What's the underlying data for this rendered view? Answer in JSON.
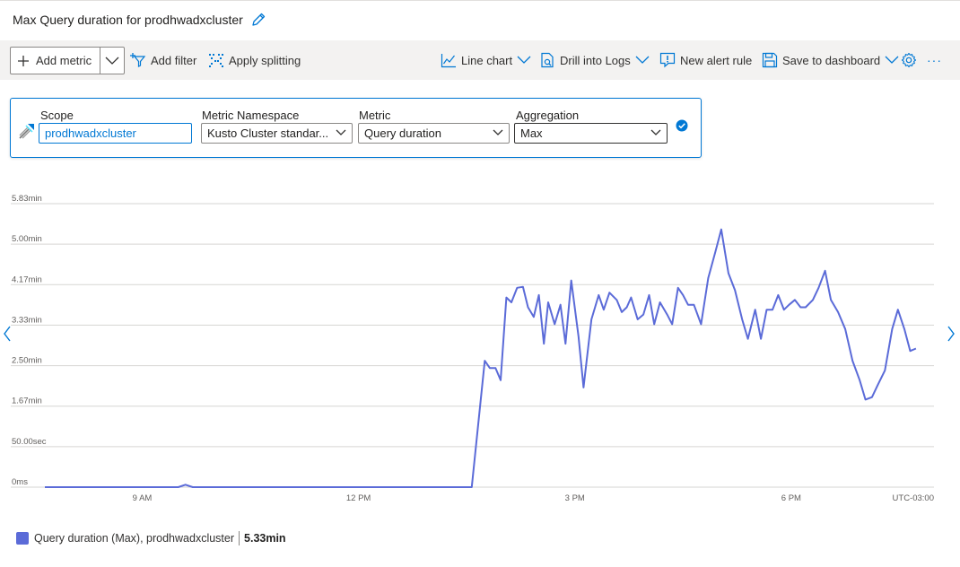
{
  "title": "Max Query duration for prodhwadxcluster",
  "toolbar": {
    "add_metric": "Add metric",
    "add_filter": "Add filter",
    "apply_splitting": "Apply splitting",
    "line_chart": "Line chart",
    "drill_logs": "Drill into Logs",
    "new_alert": "New alert rule",
    "save_dashboard": "Save to dashboard",
    "more": "···"
  },
  "metric_card": {
    "scope_label": "Scope",
    "scope_value": "prodhwadxcluster",
    "namespace_label": "Metric Namespace",
    "namespace_value": "Kusto Cluster standar...",
    "metric_label": "Metric",
    "metric_value": "Query duration",
    "aggregation_label": "Aggregation",
    "aggregation_value": "Max"
  },
  "colors": {
    "accent": "#0078d4",
    "series": "#5b6bd8",
    "grid": "#d6d5d3"
  },
  "chart_data": {
    "type": "line",
    "y_tick_labels": [
      "0ms",
      "50.00sec",
      "1.67min",
      "2.50min",
      "3.33min",
      "4.17min",
      "5.00min",
      "5.83min"
    ],
    "ylim": [
      0,
      5.83
    ],
    "y_unit": "min",
    "x_tick_labels": [
      "9 AM",
      "12 PM",
      "3 PM",
      "6 PM"
    ],
    "x_tick_hours": [
      9,
      12,
      15,
      18
    ],
    "timezone_label": "UTC-03:00",
    "xlim_hours": [
      7.65,
      19.98
    ],
    "series": [
      {
        "name": "Query duration (Max), prodhwadxcluster",
        "points": [
          [
            7.65,
            0
          ],
          [
            9.5,
            0
          ],
          [
            9.6,
            0.05
          ],
          [
            9.7,
            0
          ],
          [
            13.57,
            0
          ],
          [
            13.75,
            2.6
          ],
          [
            13.82,
            2.45
          ],
          [
            13.9,
            2.45
          ],
          [
            13.97,
            2.2
          ],
          [
            14.05,
            3.9
          ],
          [
            14.12,
            3.8
          ],
          [
            14.2,
            4.1
          ],
          [
            14.28,
            4.12
          ],
          [
            14.35,
            3.7
          ],
          [
            14.43,
            3.5
          ],
          [
            14.5,
            3.95
          ],
          [
            14.57,
            2.95
          ],
          [
            14.63,
            3.8
          ],
          [
            14.72,
            3.35
          ],
          [
            14.8,
            3.75
          ],
          [
            14.87,
            2.95
          ],
          [
            14.95,
            4.25
          ],
          [
            15.05,
            3.1
          ],
          [
            15.12,
            2.05
          ],
          [
            15.23,
            3.45
          ],
          [
            15.33,
            3.95
          ],
          [
            15.4,
            3.65
          ],
          [
            15.48,
            4.0
          ],
          [
            15.58,
            3.85
          ],
          [
            15.65,
            3.6
          ],
          [
            15.72,
            3.7
          ],
          [
            15.78,
            3.9
          ],
          [
            15.87,
            3.45
          ],
          [
            15.95,
            3.55
          ],
          [
            16.03,
            3.95
          ],
          [
            16.1,
            3.35
          ],
          [
            16.18,
            3.8
          ],
          [
            16.28,
            3.55
          ],
          [
            16.35,
            3.35
          ],
          [
            16.43,
            4.1
          ],
          [
            16.5,
            3.95
          ],
          [
            16.57,
            3.75
          ],
          [
            16.65,
            3.75
          ],
          [
            16.75,
            3.35
          ],
          [
            16.85,
            4.3
          ],
          [
            16.95,
            4.85
          ],
          [
            17.03,
            5.3
          ],
          [
            17.13,
            4.4
          ],
          [
            17.22,
            4.05
          ],
          [
            17.32,
            3.45
          ],
          [
            17.4,
            3.05
          ],
          [
            17.5,
            3.65
          ],
          [
            17.58,
            3.05
          ],
          [
            17.66,
            3.65
          ],
          [
            17.74,
            3.65
          ],
          [
            17.82,
            3.95
          ],
          [
            17.9,
            3.65
          ],
          [
            17.97,
            3.75
          ],
          [
            18.05,
            3.85
          ],
          [
            18.13,
            3.7
          ],
          [
            18.2,
            3.7
          ],
          [
            18.3,
            3.85
          ],
          [
            18.38,
            4.1
          ],
          [
            18.47,
            4.45
          ],
          [
            18.55,
            3.85
          ],
          [
            18.65,
            3.6
          ],
          [
            18.75,
            3.25
          ],
          [
            18.85,
            2.6
          ],
          [
            18.95,
            2.2
          ],
          [
            19.03,
            1.8
          ],
          [
            19.12,
            1.85
          ],
          [
            19.2,
            2.1
          ],
          [
            19.3,
            2.4
          ],
          [
            19.4,
            3.25
          ],
          [
            19.48,
            3.65
          ],
          [
            19.57,
            3.25
          ],
          [
            19.65,
            2.8
          ],
          [
            19.73,
            2.85
          ]
        ]
      }
    ],
    "legend": {
      "label": "Query duration (Max), prodhwadxcluster",
      "value": "5.33min"
    }
  }
}
